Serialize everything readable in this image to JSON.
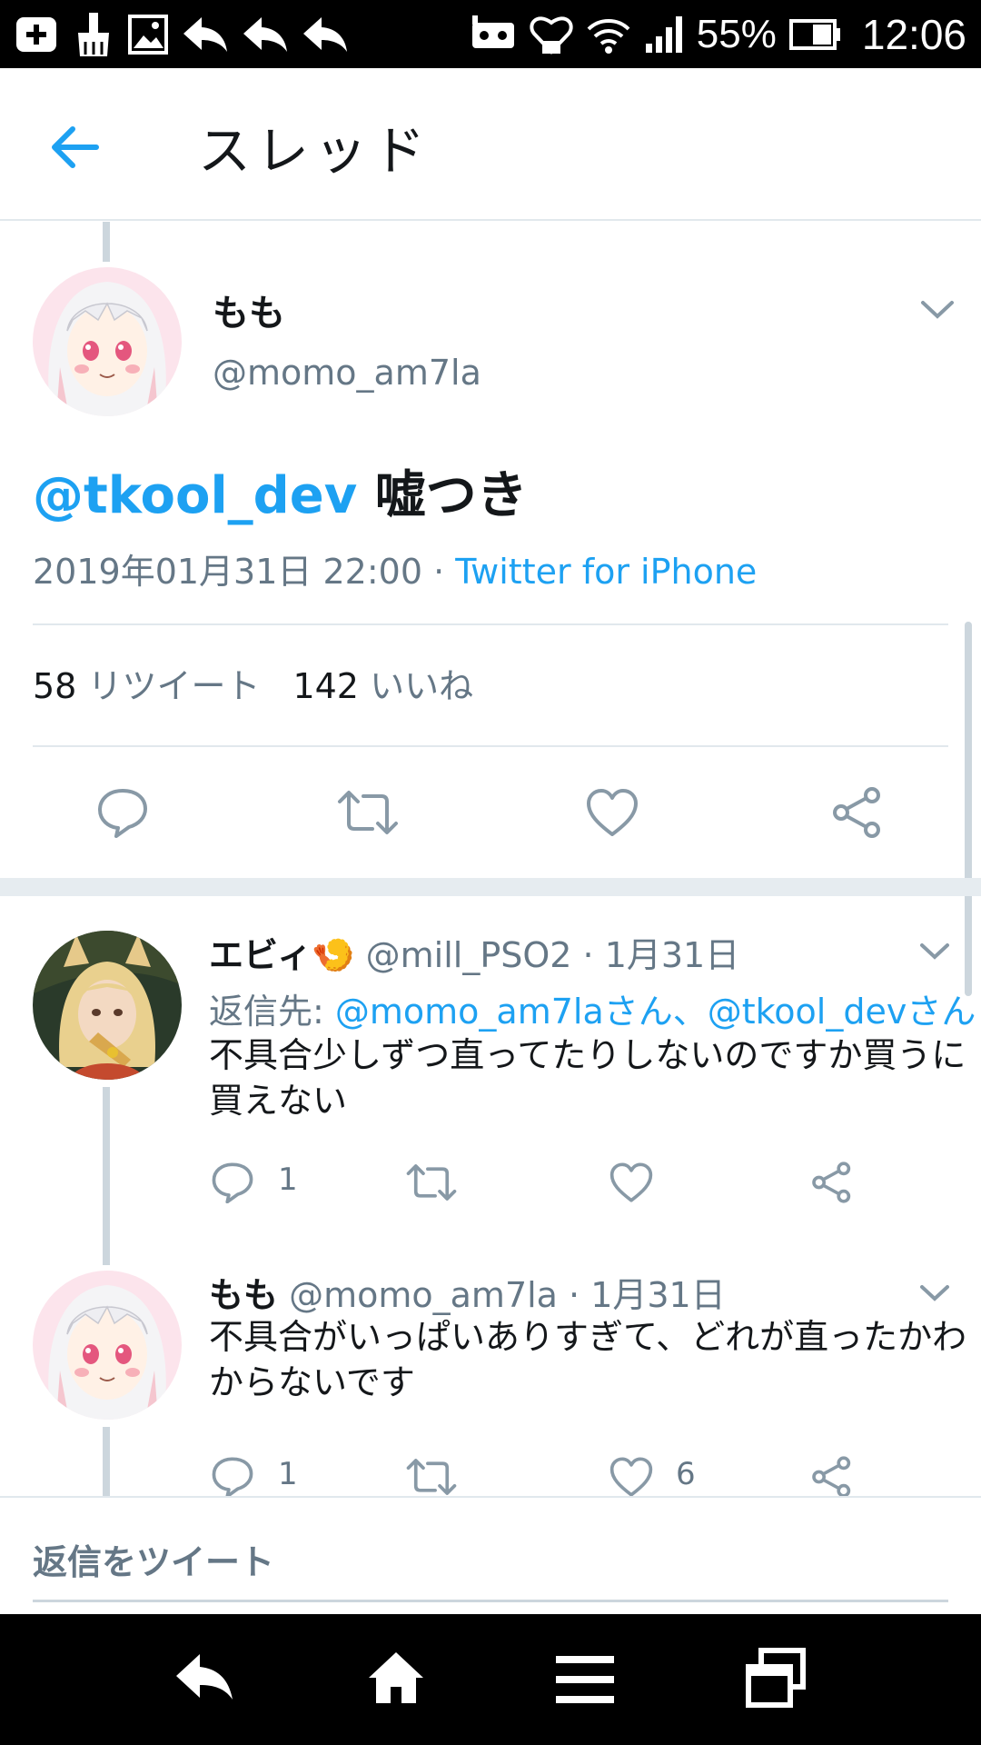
{
  "status_bar": {
    "battery": "55%",
    "time": "12:06"
  },
  "header": {
    "title": "スレッド"
  },
  "main_tweet": {
    "name": "もも",
    "handle": "@momo_am7la",
    "mention": "@tkool_dev",
    "text": " 嘘つき",
    "datetime": "2019年01月31日 22:00 · ",
    "client": "Twitter for iPhone",
    "retweet_count": "58",
    "retweet_label": " リツイート",
    "like_count": "142",
    "like_label": " いいね"
  },
  "replies": [
    {
      "name": "エビィ🍤",
      "handle": "@mill_PSO2",
      "date": " · 1月31日",
      "reply_to_label": "返信先: ",
      "reply_to": "@momo_am7laさん、@tkool_devさん",
      "text": "不具合少しずつ直ってたりしないのですか買うに買えない",
      "reply_count": "1",
      "retweet_count": "",
      "like_count": ""
    },
    {
      "name": "もも",
      "handle": "@momo_am7la",
      "date": " · 1月31日",
      "text": "不具合がいっぱいありすぎて、どれが直ったかわからないです",
      "reply_count": "1",
      "retweet_count": "",
      "like_count": "6"
    }
  ],
  "compose": {
    "placeholder": "返信をツイート"
  },
  "colors": {
    "accent": "#1da1f2",
    "secondary_text": "#657786",
    "divider": "#e1e8ed",
    "thread_line": "#ccd6dd"
  },
  "icons": {
    "back": "arrow-left-icon",
    "reply": "reply-bubble-icon",
    "retweet": "retweet-icon",
    "like": "heart-icon",
    "share": "share-icon",
    "menu": "chevron-down-icon"
  }
}
